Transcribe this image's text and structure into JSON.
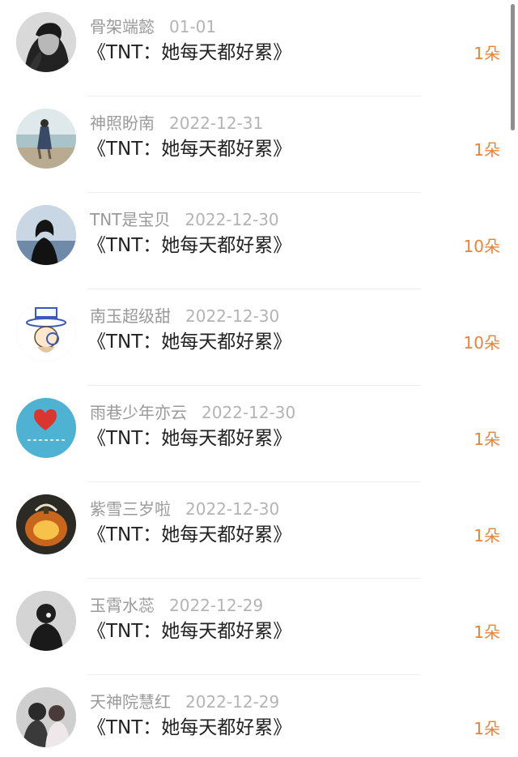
{
  "colors": {
    "accent_count": "#e7833a",
    "meta_text": "#9a9a9a",
    "title_text": "#222222"
  },
  "items": [
    {
      "name": "骨架端懿",
      "date": "01-01",
      "title": "《TNT：她每天都好累》",
      "count": "1朵",
      "avatar_icon": "man-portrait-avatar"
    },
    {
      "name": "神照盼南",
      "date": "2022-12-31",
      "title": "《TNT：她每天都好累》",
      "count": "1朵",
      "avatar_icon": "beach-figure-avatar"
    },
    {
      "name": "TNT是宝贝",
      "date": "2022-12-30",
      "title": "《TNT：她每天都好累》",
      "count": "10朵",
      "avatar_icon": "girl-silhouette-avatar"
    },
    {
      "name": "南玉超级甜",
      "date": "2022-12-30",
      "title": "《TNT：她每天都好累》",
      "count": "10朵",
      "avatar_icon": "cartoon-detective-avatar"
    },
    {
      "name": "雨巷少年亦云",
      "date": "2022-12-30",
      "title": "《TNT：她每天都好累》",
      "count": "1朵",
      "avatar_icon": "blue-heart-avatar"
    },
    {
      "name": "紫雪三岁啦",
      "date": "2022-12-30",
      "title": "《TNT：她每天都好累》",
      "count": "1朵",
      "avatar_icon": "pumpkin-avatar"
    },
    {
      "name": "玉霄水蕊",
      "date": "2022-12-29",
      "title": "《TNT：她每天都好累》",
      "count": "1朵",
      "avatar_icon": "dark-figure-avatar"
    },
    {
      "name": "天神院慧红",
      "date": "2022-12-29",
      "title": "《TNT：她每天都好累》",
      "count": "1朵",
      "avatar_icon": "couple-photo-avatar"
    }
  ]
}
